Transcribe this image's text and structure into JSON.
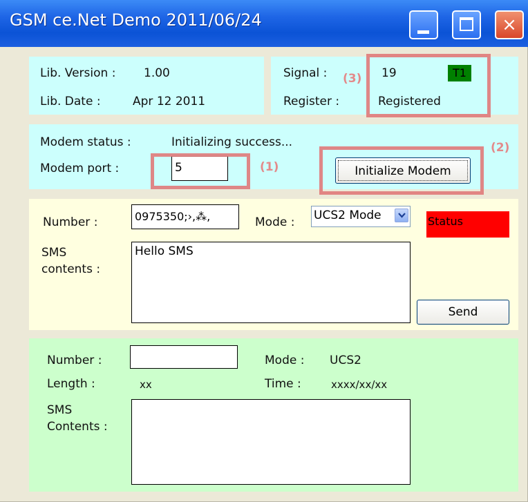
{
  "window": {
    "title": "GSM ce.Net Demo 2011/06/24",
    "controls": {
      "minimize": "minimize",
      "maximize": "maximize",
      "close": "×"
    }
  },
  "info": {
    "lib_version_label": "Lib. Version :",
    "lib_version_value": "1.00",
    "lib_date_label": "Lib. Date :",
    "lib_date_value": "Apr 12 2011",
    "signal_label": "Signal :",
    "signal_value": "19",
    "signal_badge": "T1",
    "register_label": "Register :",
    "register_value": "Registered"
  },
  "modem": {
    "status_label": "Modem status :",
    "status_value": "Initializing success...",
    "port_label": "Modem port :",
    "port_value": "5",
    "init_button": "Initialize Modem"
  },
  "send_sms": {
    "number_label": "Number :",
    "number_value": "0975350;›,⁂,",
    "mode_label": "Mode :",
    "mode_selected": "UCS2 Mode",
    "status_text": "Status",
    "contents_label_line1": "SMS",
    "contents_label_line2": "contents :",
    "contents_value": "Hello SMS",
    "send_button": "Send"
  },
  "recv_sms": {
    "number_label": "Number :",
    "number_value": "",
    "mode_label": "Mode :",
    "mode_value": "UCS2",
    "length_label": "Length :",
    "length_value": "xx",
    "time_label": "Time :",
    "time_value": "xxxx/xx/xx",
    "contents_label_line1": "SMS",
    "contents_label_line2": "Contents :",
    "contents_value": ""
  },
  "annotations": {
    "a1": "(1)",
    "a2": "(2)",
    "a3": "(3)"
  },
  "colors": {
    "info_panel": "#ccfffd",
    "send_panel": "#ffffe0",
    "recv_panel": "#ccffcc",
    "status_red": "#ff0000",
    "signal_badge_green": "#008000",
    "highlight": "#e07a7a"
  }
}
